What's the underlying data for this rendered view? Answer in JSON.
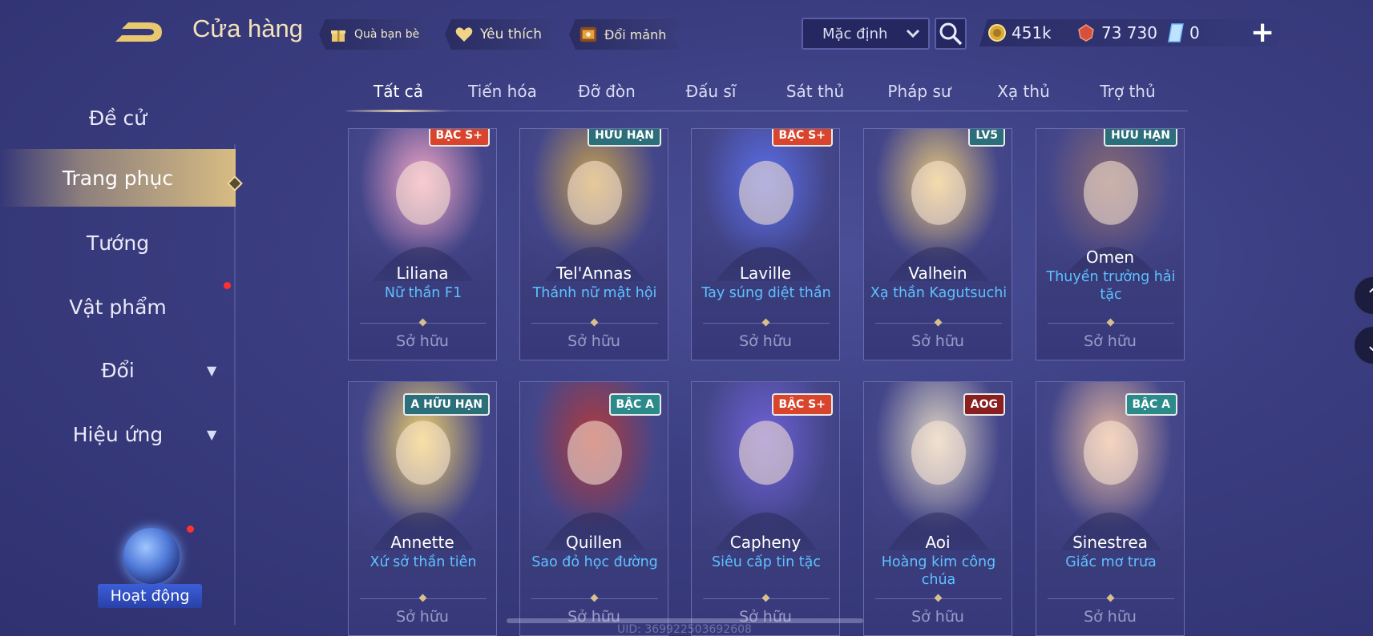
{
  "header": {
    "title": "Cửa hàng",
    "buttons": [
      {
        "label": "Quà bạn bè",
        "icon": "gift-icon"
      },
      {
        "label": "Yêu thích",
        "icon": "heart-icon"
      },
      {
        "label": "Đổi mảnh",
        "icon": "fragment-chest-icon"
      }
    ],
    "sort_value": "Mặc định",
    "currencies": [
      {
        "value": "451k",
        "icon": "gold-coin-icon"
      },
      {
        "value": "73 730",
        "icon": "red-gem-icon"
      },
      {
        "value": "0",
        "icon": "voucher-icon"
      }
    ]
  },
  "sidebar": {
    "items": [
      {
        "label": "Đề cử"
      },
      {
        "label": "Trang phục"
      },
      {
        "label": "Tướng"
      },
      {
        "label": "Vật phẩm"
      },
      {
        "label": "Đổi"
      },
      {
        "label": "Hiệu ứng"
      }
    ],
    "activity_label": "Hoạt động"
  },
  "tabs": [
    "Tất cả",
    "Tiến hóa",
    "Đỡ đòn",
    "Đấu sĩ",
    "Sát thủ",
    "Pháp sư",
    "Xạ thủ",
    "Trợ thủ"
  ],
  "cards": [
    {
      "hero": "Liliana",
      "skin": "Nữ thần F1",
      "status": "Sở hữu",
      "badge": "BẬC S+",
      "accent": "#f3a6c6"
    },
    {
      "hero": "Tel'Annas",
      "skin": "Thánh nữ mật hội",
      "status": "Sở hữu",
      "badge": "HỮU HẠN",
      "accent": "#c9a24f"
    },
    {
      "hero": "Laville",
      "skin": "Tay súng diệt thần",
      "status": "Sở hữu",
      "badge": "BẬC S+",
      "accent": "#5b6ee8"
    },
    {
      "hero": "Valhein",
      "skin": "Xạ thần Kagutsuchi",
      "status": "Sở hữu",
      "badge": "LV5",
      "accent": "#e7c77a"
    },
    {
      "hero": "Omen",
      "skin": "Thuyền trưởng hải tặc",
      "status": "Sở hữu",
      "badge": "HỮU HẠN",
      "accent": "#8c6b72"
    },
    {
      "hero": "Annette",
      "skin": "Xứ sở thần tiên",
      "status": "Sở hữu",
      "badge": "A HỮU HẠN",
      "accent": "#f2d36a"
    },
    {
      "hero": "Quillen",
      "skin": "Sao đỏ học đường",
      "status": "Sở hữu",
      "badge": "BẬC A",
      "accent": "#b23a3a"
    },
    {
      "hero": "Capheny",
      "skin": "Siêu cấp tin tặc",
      "status": "Sở hữu",
      "badge": "BẬC S+",
      "accent": "#6f62d8"
    },
    {
      "hero": "Aoi",
      "skin": "Hoàng kim công chúa",
      "status": "Sở hữu",
      "badge": "AOG",
      "accent": "#e0d6c4"
    },
    {
      "hero": "Sinestrea",
      "skin": "Giấc mơ trưa",
      "status": "Sở hữu",
      "badge": "BẬC A",
      "accent": "#e7b9a1"
    }
  ],
  "footer": {
    "uid": "UID: 369922503692608"
  },
  "colors": {
    "accent_gold": "#d7bc82",
    "skin_name_blue": "#5fc1ff",
    "badge_splus": "#d8452c",
    "badge_a": "#2b8a8a"
  }
}
